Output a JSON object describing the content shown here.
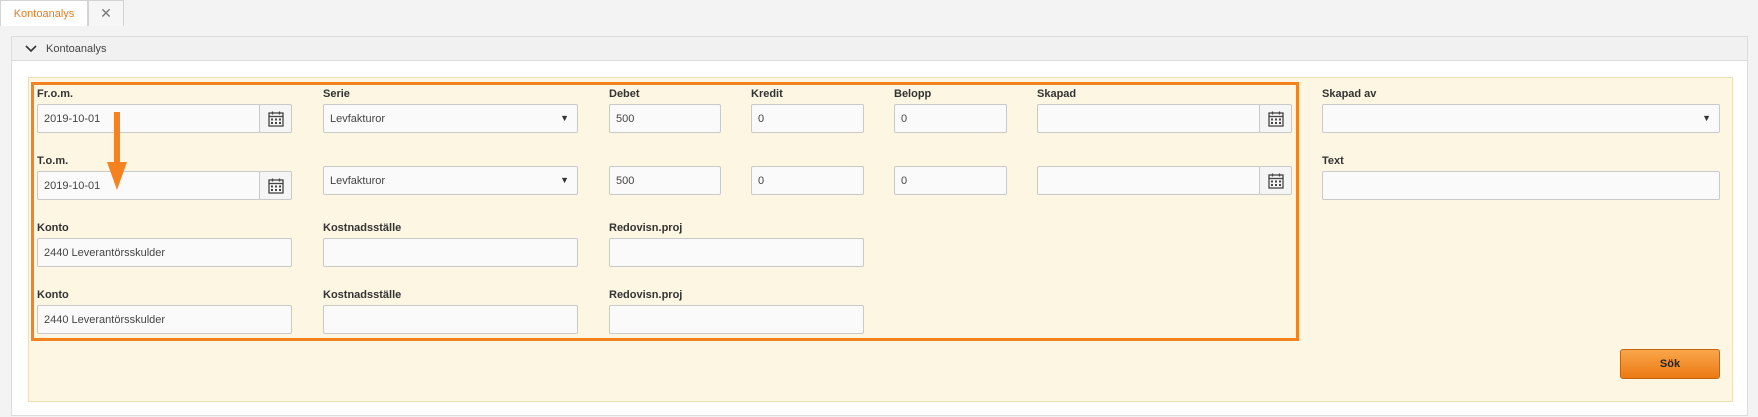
{
  "tabs": {
    "active_label": "Kontoanalys",
    "close_glyph": "✕"
  },
  "panel": {
    "title": "Kontoanalys"
  },
  "form": {
    "from_label": "Fr.o.m.",
    "from_value": "2019-10-01",
    "to_label": "T.o.m.",
    "to_value": "2019-10-01",
    "serie_label": "Serie",
    "serie_from": "Levfakturor",
    "serie_to": "Levfakturor",
    "debet_label": "Debet",
    "debet_from": "500",
    "debet_to": "500",
    "kredit_label": "Kredit",
    "kredit_from": "0",
    "kredit_to": "0",
    "belopp_label": "Belopp",
    "belopp_from": "0",
    "belopp_to": "0",
    "skapad_label": "Skapad",
    "skapad_from": "",
    "skapad_to": "",
    "skapad_av_label": "Skapad av",
    "skapad_av_value": "",
    "text_label": "Text",
    "text_value": "",
    "konto_label_1": "Konto",
    "konto_value_1": "2440 Leverantörsskulder",
    "konto_label_2": "Konto",
    "konto_value_2": "2440 Leverantörsskulder",
    "kostnadsstalle_label_1": "Kostnadsställe",
    "kostnadsstalle_value_1": "",
    "kostnadsstalle_label_2": "Kostnadsställe",
    "kostnadsstalle_value_2": "",
    "redovisn_label_1": "Redovisn.proj",
    "redovisn_value_1": "",
    "redovisn_label_2": "Redovisn.proj",
    "redovisn_value_2": "",
    "search_button": "Sök"
  },
  "colors": {
    "accent": "#f5821f",
    "form_background": "#fcf6e2",
    "tab_active_text": "#e97a1f"
  },
  "icons": [
    "close-icon",
    "chevron-down-icon",
    "calendar-icon",
    "dropdown-caret-icon",
    "arrow-down-annotation"
  ]
}
